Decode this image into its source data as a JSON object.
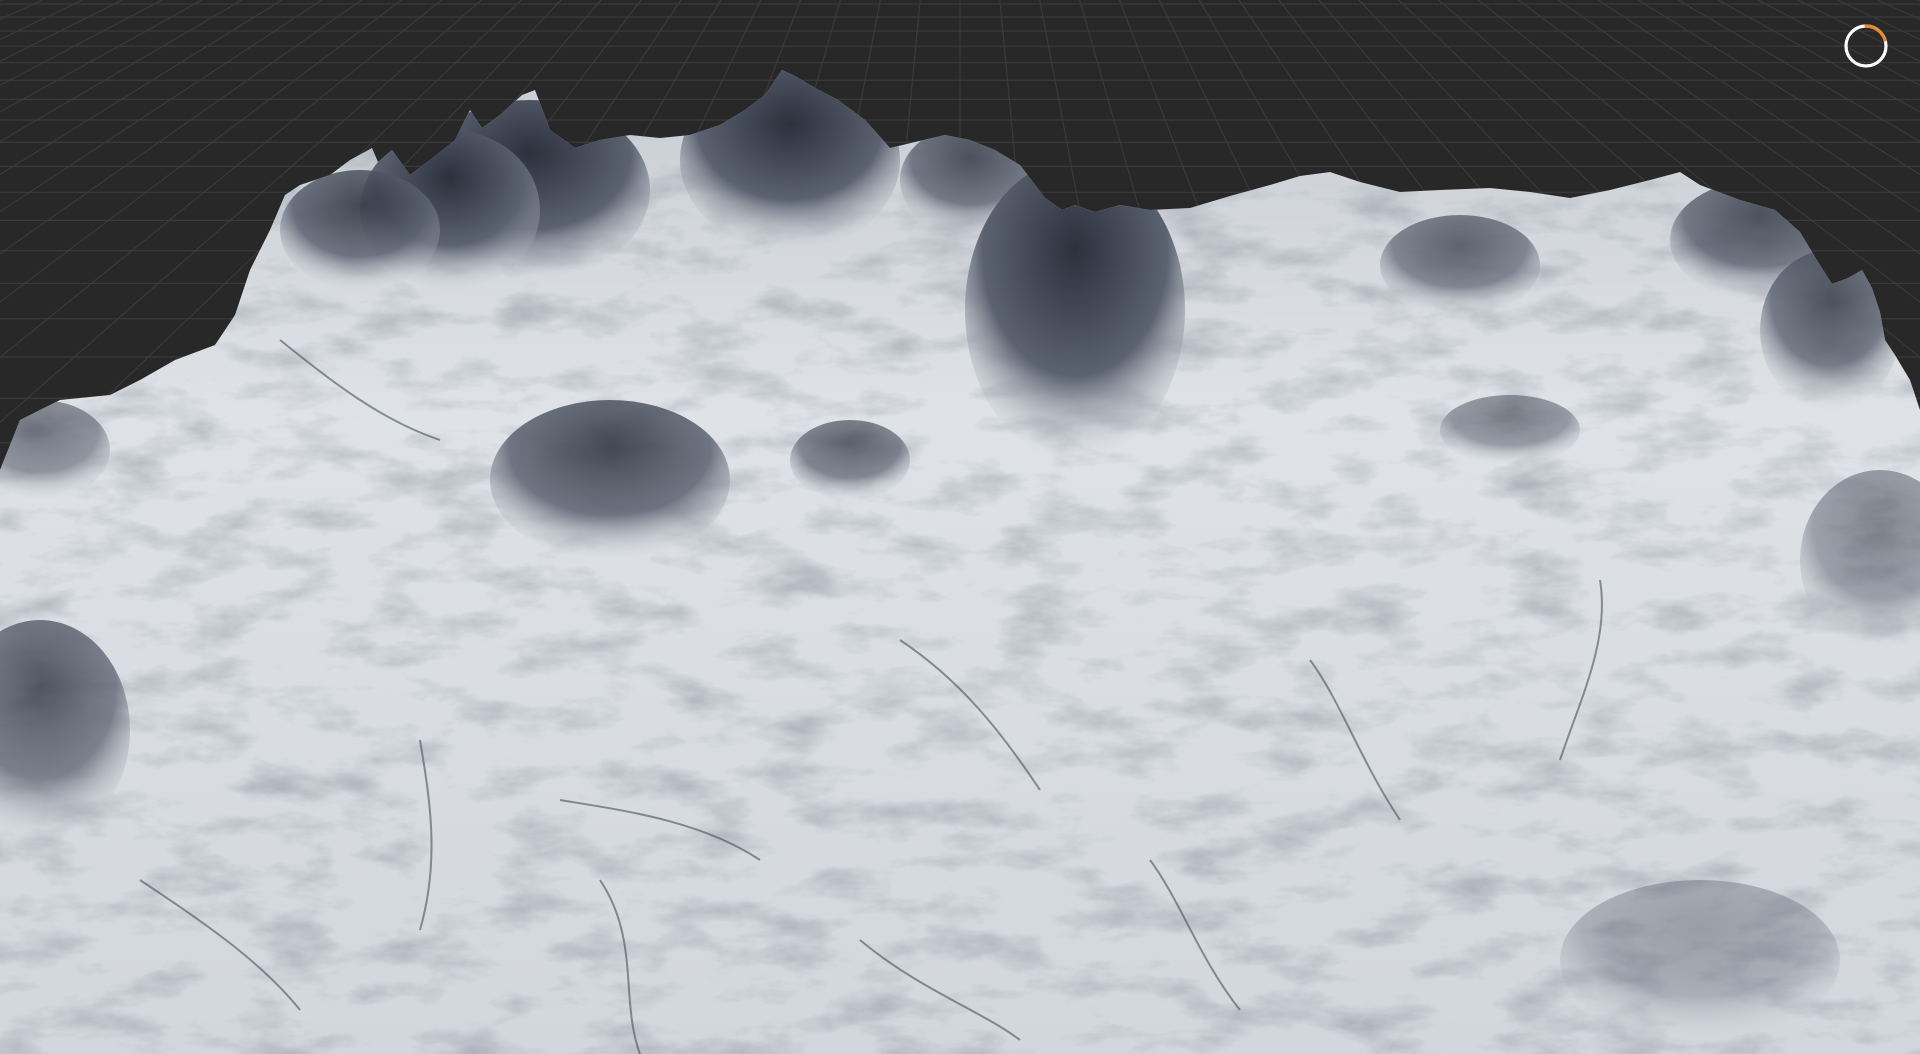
{
  "viewport": {
    "background_color": "#282828",
    "grid_color": "#3a3a3a",
    "terrain_light_color": "#d4d8df",
    "terrain_shadow_color": "#2a303c"
  },
  "loading_indicator": {
    "icon": "loading-spinner-icon",
    "track_color": "#ffffff",
    "accent_color": "#e8892c"
  }
}
